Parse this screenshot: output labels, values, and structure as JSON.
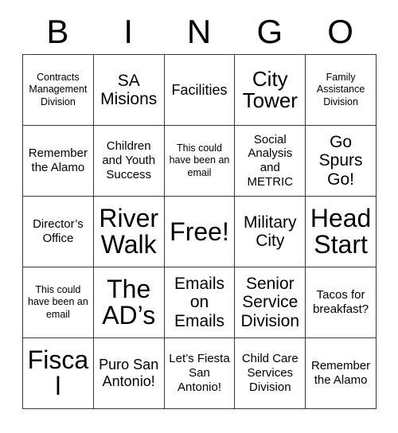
{
  "card": {
    "title_letters": [
      "B",
      "I",
      "N",
      "G",
      "O"
    ],
    "rows": [
      [
        {
          "text": "Contracts Management Division",
          "size": "xs"
        },
        {
          "text": "SA Misions",
          "size": "l"
        },
        {
          "text": "Facilities",
          "size": "m"
        },
        {
          "text": "City Tower",
          "size": "xl"
        },
        {
          "text": "Family Assistance Division",
          "size": "xs"
        }
      ],
      [
        {
          "text": "Remember the Alamo",
          "size": "s"
        },
        {
          "text": "Children and Youth Success",
          "size": "s"
        },
        {
          "text": "This could have been an email",
          "size": "xs"
        },
        {
          "text": "Social Analysis and METRIC",
          "size": "s"
        },
        {
          "text": "Go Spurs Go!",
          "size": "l"
        }
      ],
      [
        {
          "text": "Director’s Office",
          "size": "s"
        },
        {
          "text": "River Walk",
          "size": "xxl"
        },
        {
          "text": "Free!",
          "size": "xxl"
        },
        {
          "text": "Military City",
          "size": "l"
        },
        {
          "text": "Head Start",
          "size": "xxl"
        }
      ],
      [
        {
          "text": "This could have been an email",
          "size": "xs"
        },
        {
          "text": "The AD’s",
          "size": "xxl"
        },
        {
          "text": "Emails on Emails",
          "size": "l"
        },
        {
          "text": "Senior Service Division",
          "size": "l"
        },
        {
          "text": "Tacos for breakfast?",
          "size": "s"
        }
      ],
      [
        {
          "text": "Fiscal",
          "size": "xxl"
        },
        {
          "text": "Puro San Antonio!",
          "size": "m"
        },
        {
          "text": "Let’s Fiesta San Antonio!",
          "size": "s"
        },
        {
          "text": "Child Care Services Division",
          "size": "s"
        },
        {
          "text": "Remember the Alamo",
          "size": "s"
        }
      ]
    ]
  },
  "colors": {
    "background": "#ffffff",
    "border": "#3a3a3a",
    "text": "#000000"
  }
}
